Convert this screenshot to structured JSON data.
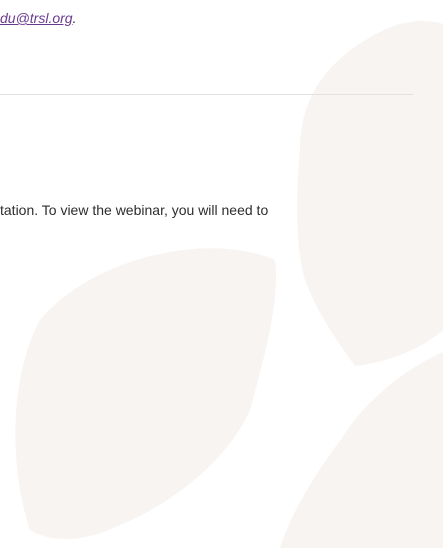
{
  "contact": {
    "email_fragment": "du@trsl.org",
    "trailing_punctuation": "."
  },
  "body": {
    "sentence_fragment": "tation. To view the webinar, you will need to"
  },
  "colors": {
    "link": "#6a3a8f",
    "text": "#2d2d2d",
    "rule": "#e6e2df",
    "watermark": "#f7f4f1"
  }
}
